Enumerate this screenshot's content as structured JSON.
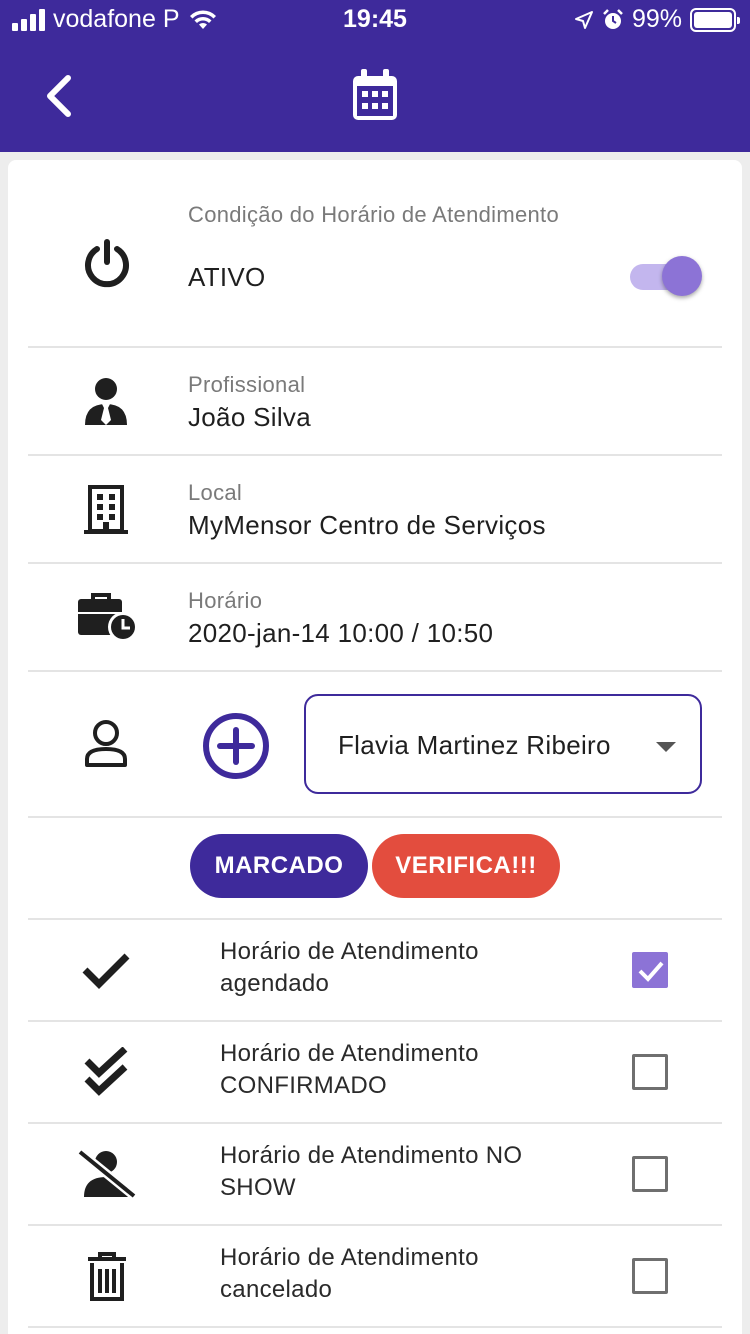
{
  "status_bar": {
    "carrier": "vodafone P",
    "time": "19:45",
    "battery": "99%",
    "battery_level": 0.99
  },
  "app_bar": {
    "back_icon": "chevron-left-icon",
    "center_icon": "calendar-icon"
  },
  "condition": {
    "label": "Condição do Horário de Atendimento",
    "value": "ATIVO",
    "icon": "power-icon",
    "toggle_on": true
  },
  "professional": {
    "label": "Profissional",
    "value": "João Silva",
    "icon": "person-tie-icon"
  },
  "location": {
    "label": "Local",
    "value": "MyMensor Centro de Serviços",
    "icon": "building-icon"
  },
  "schedule": {
    "label": "Horário",
    "value": "2020-jan-14 10:00 / 10:50",
    "icon": "briefcase-clock-icon"
  },
  "client": {
    "selected": "Flavia Martinez Ribeiro",
    "person_icon": "person-outline-icon",
    "add_icon": "add-circle-icon"
  },
  "status_buttons": {
    "marked": "MARCADO",
    "verify": "VERIFICA!!!"
  },
  "statuses": [
    {
      "icon": "check-icon",
      "line1": "Horário de Atendimento",
      "line2": "agendado",
      "checked": true
    },
    {
      "icon": "double-check-icon",
      "line1": "Horário de Atendimento",
      "line2": "CONFIRMADO",
      "checked": false
    },
    {
      "icon": "person-off-icon",
      "line1": "Horário de Atendimento NO",
      "line2": "SHOW",
      "checked": false
    },
    {
      "icon": "trash-icon",
      "line1": "Horário de Atendimento",
      "line2": "cancelado",
      "checked": false
    }
  ],
  "colors": {
    "primary": "#3e2a9b",
    "accent": "#8c73d6",
    "danger": "#e34d3e"
  }
}
